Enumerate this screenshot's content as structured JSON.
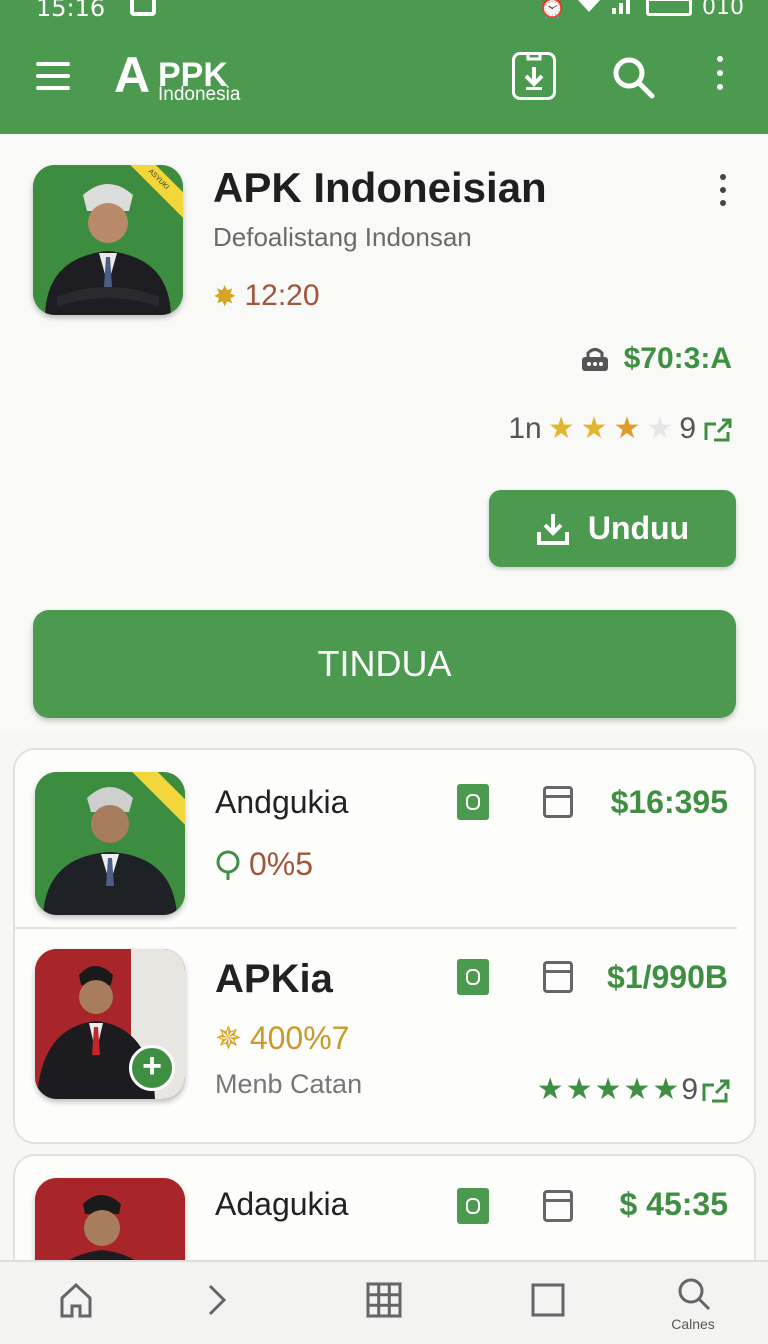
{
  "status_bar": {
    "time": "15:16",
    "right_text": "010"
  },
  "app_bar": {
    "logo_letter": "A",
    "logo_main": "PPK",
    "logo_sub": "Indonesia",
    "icons": [
      "menu-icon",
      "download-box-icon",
      "search-icon",
      "more-vert-icon"
    ]
  },
  "hero": {
    "title": "APK Indoneisian",
    "subtitle": "Defoalistang Indonsan",
    "time_value": "12:20",
    "price": "$70:3:A",
    "rating_prefix": "1n",
    "stars_filled": 3,
    "stars_total": 4,
    "rating_suffix": "9",
    "unduh_label": "Unduu",
    "tindua_label": "TINDUA",
    "badge_text": "ASYUKI"
  },
  "list": [
    {
      "name": "Andgukia",
      "meta": "0%5",
      "meta_icon": "location-pin-icon",
      "price": "$16:395"
    },
    {
      "name": "APKia",
      "meta": "400%7",
      "meta_icon": "star-burst-icon",
      "price": "$1/990B",
      "sub": "Menb Catan",
      "stars_count": 5,
      "stars_suffix": "9"
    },
    {
      "name": "Adagukia",
      "price": "$ 45:35"
    }
  ],
  "bottom_nav": {
    "items": [
      "home-icon",
      "chevron-right-icon",
      "grid-icon",
      "square-icon",
      "search-icon"
    ],
    "last_label": "Calnes"
  },
  "colors": {
    "primary": "#4c9a50",
    "price_green": "#3f8f43",
    "rating_brown": "#a1553c",
    "gold": "#d6a322"
  }
}
